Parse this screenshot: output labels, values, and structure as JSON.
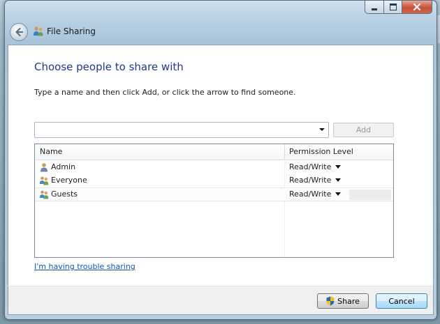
{
  "window": {
    "title": "File Sharing",
    "caption_buttons": [
      "minimize",
      "maximize",
      "close"
    ]
  },
  "dialog": {
    "heading": "Choose people to share with",
    "instructions": "Type a name and then click Add, or click the arrow to find someone.",
    "name_input": {
      "value": "",
      "placeholder": ""
    },
    "add_button": "Add"
  },
  "list": {
    "columns": [
      "Name",
      "Permission Level"
    ],
    "rows": [
      {
        "name": "Admin",
        "permission": "Read/Write",
        "icon": "user-icon"
      },
      {
        "name": "Everyone",
        "permission": "Read/Write",
        "icon": "group-icon"
      },
      {
        "name": "Guests",
        "permission": "Read/Write",
        "icon": "group-icon",
        "selected": true
      }
    ]
  },
  "trouble_link": "I'm having trouble sharing",
  "footer": {
    "share_button": "Share",
    "cancel_button": "Cancel"
  },
  "colors": {
    "heading": "#1e3a8a",
    "link": "#0d56b5",
    "frame": "#b7cfe2",
    "close_button": "#c75039"
  }
}
